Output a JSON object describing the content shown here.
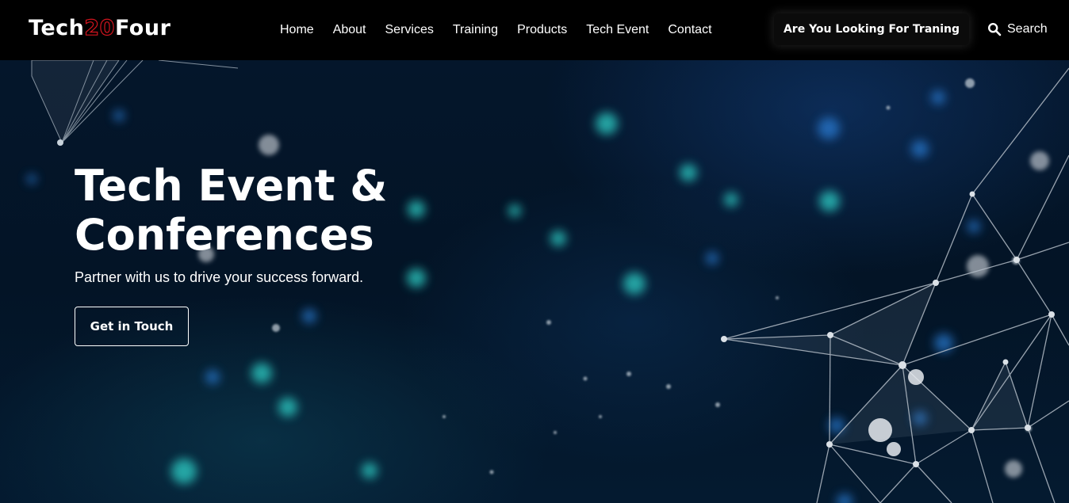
{
  "header": {
    "logo": {
      "part1": "Tech",
      "part2": "20",
      "part3": "Four"
    },
    "nav": [
      {
        "label": "Home"
      },
      {
        "label": "About"
      },
      {
        "label": "Services"
      },
      {
        "label": "Training"
      },
      {
        "label": "Products"
      },
      {
        "label": "Tech Event"
      },
      {
        "label": "Contact"
      }
    ],
    "cta_label": "Are You Looking For Traning",
    "search_label": "Search"
  },
  "hero": {
    "title_line1": "Tech Event &",
    "title_line2": "Conferences",
    "subtitle": "Partner with us to drive your success forward.",
    "button_label": "Get in Touch"
  },
  "colors": {
    "header_bg": "#000000",
    "logo_accent": "#d3141e",
    "hero_bg": "#03101f",
    "glow_cyan": "#2fd0c8",
    "glow_blue": "#2a7fd8",
    "text": "#ffffff"
  },
  "icons": {
    "search": "search-icon"
  }
}
